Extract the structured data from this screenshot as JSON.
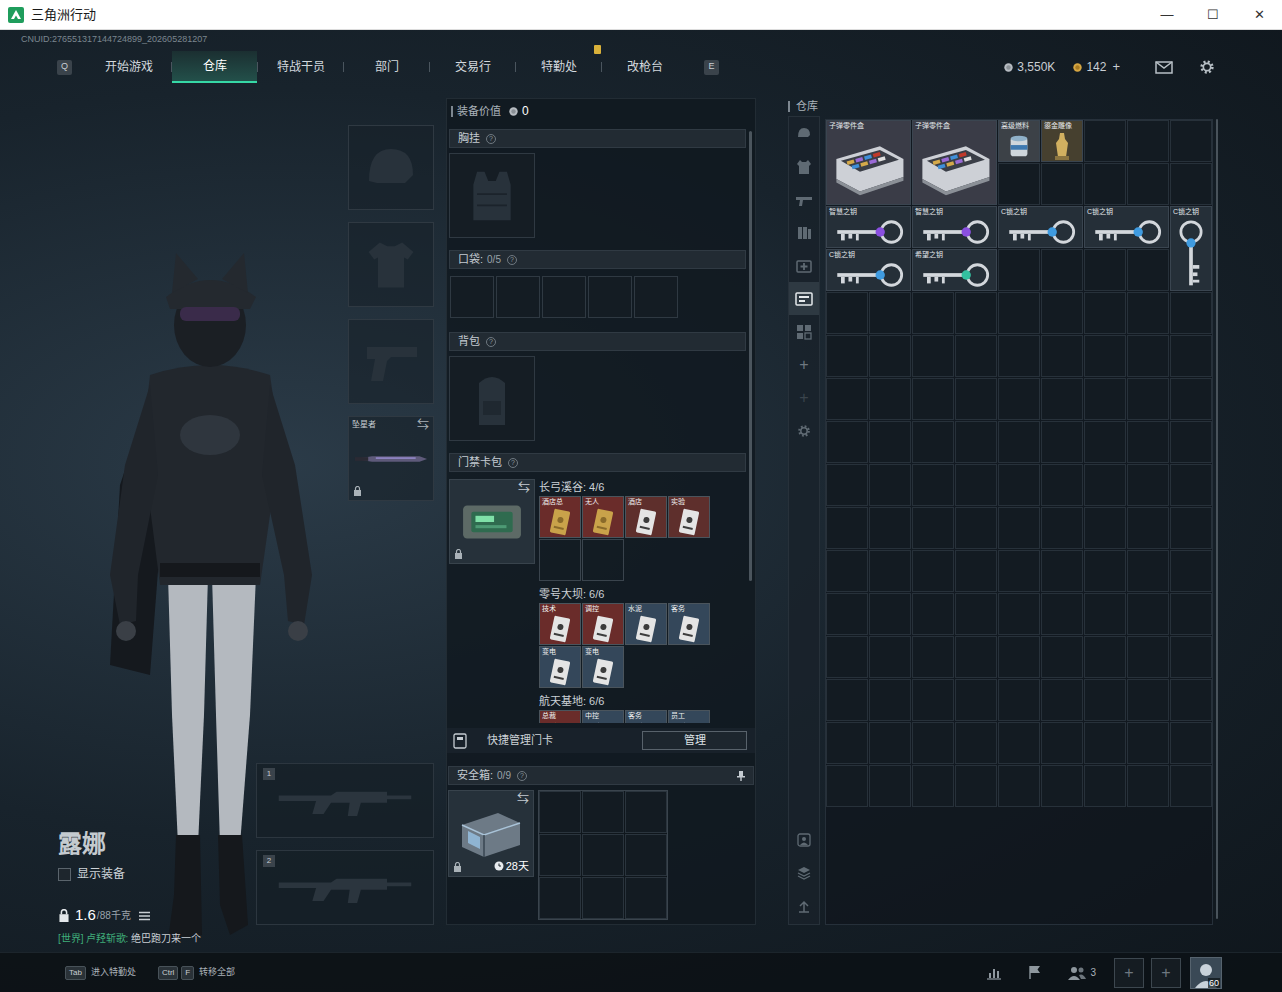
{
  "window": {
    "title": "三角洲行动",
    "controls": [
      "—",
      "☐",
      "✕"
    ]
  },
  "cnuid": "CNUID:276551317144724899_202605281207",
  "nav": {
    "prev_key": "Q",
    "next_key": "E",
    "tabs": [
      {
        "label": "开始游戏",
        "selected": false,
        "badge": false
      },
      {
        "label": "仓库",
        "selected": true,
        "badge": false
      },
      {
        "label": "特战干员",
        "selected": false,
        "badge": false
      },
      {
        "label": "部门",
        "selected": false,
        "badge": false
      },
      {
        "label": "交易行",
        "selected": false,
        "badge": false
      },
      {
        "label": "特勤处",
        "selected": false,
        "badge": true
      },
      {
        "label": "改枪台",
        "selected": false,
        "badge": false
      }
    ],
    "currencies": [
      {
        "amount": "3,550K",
        "kind": "silver"
      },
      {
        "amount": "142",
        "kind": "gold",
        "add": "+"
      }
    ]
  },
  "operator": {
    "name": "露娜",
    "show_equipment": {
      "label": "显示装备",
      "checked": false
    },
    "weight": "1.6",
    "weight_max": "/88千克"
  },
  "chat": {
    "channel": "[世界]",
    "sender": "卢羟斩歌:",
    "message": "绝巴跑刀来一个"
  },
  "gear_slots": [
    {
      "kind": "helmet"
    },
    {
      "kind": "armor"
    },
    {
      "kind": "pistol"
    },
    {
      "kind": "melee",
      "label": "坠星者",
      "swap": "⇆",
      "locked": true
    }
  ],
  "weapon_slots": [
    {
      "number": "1"
    },
    {
      "number": "2"
    }
  ],
  "loadout": {
    "value_label": "装备价值",
    "value": "0",
    "chest_rig": {
      "title": "胸挂",
      "help": "?"
    },
    "pockets": {
      "title": "口袋:",
      "count": "0/5",
      "help": "?",
      "slots": [
        {
          "filled": false
        },
        {
          "filled": false
        },
        {
          "filled": false
        },
        {
          "filled": false
        },
        {
          "filled": false
        }
      ]
    },
    "backpack": {
      "title": "背包",
      "help": "?"
    },
    "keycard_case": {
      "title": "门禁卡包",
      "help": "?",
      "swap": "⇆",
      "locked": true,
      "groups": [
        {
          "name": "长弓溪谷: 4/6",
          "slots": [
            {
              "filled": true,
              "label": "酒店总",
              "kind": "gold",
              "color": "#6a2c2a"
            },
            {
              "filled": true,
              "label": "无人",
              "kind": "gold",
              "color": "#6a2c2a"
            },
            {
              "filled": true,
              "label": "酒店",
              "kind": "white",
              "color": "#5e2f2c"
            },
            {
              "filled": true,
              "label": "实验",
              "kind": "white",
              "color": "#5e2f2c"
            },
            {
              "filled": false
            },
            {
              "filled": false
            }
          ]
        },
        {
          "name": "零号大坝: 6/6",
          "slots": [
            {
              "filled": true,
              "label": "技术",
              "kind": "white",
              "color": "#6a2c2a"
            },
            {
              "filled": true,
              "label": "调控",
              "kind": "white",
              "color": "#6a2c2a"
            },
            {
              "filled": true,
              "label": "水泥",
              "kind": "white",
              "color": "#34475a"
            },
            {
              "filled": true,
              "label": "客务",
              "kind": "white",
              "color": "#34475a"
            },
            {
              "filled": true,
              "label": "变电",
              "kind": "white",
              "color": "#34475a"
            },
            {
              "filled": true,
              "label": "变电",
              "kind": "white",
              "color": "#34475a"
            }
          ]
        },
        {
          "name": "航天基地: 6/6",
          "slots": [
            {
              "filled": true,
              "label": "总裁",
              "kind": "gold",
              "color": "#6a2c2a"
            },
            {
              "filled": true,
              "label": "中控",
              "kind": "white",
              "color": "#34475a"
            },
            {
              "filled": true,
              "label": "客务",
              "kind": "white",
              "color": "#34475a"
            },
            {
              "filled": true,
              "label": "员工",
              "kind": "white",
              "color": "#34475a"
            }
          ]
        }
      ]
    },
    "quick_manage": {
      "label": "快捷管理门卡",
      "button": "管理"
    },
    "safe_box": {
      "title": "安全箱:",
      "count": "0/9",
      "help": "?",
      "swap": "⇆",
      "locked": true,
      "timer": "28天",
      "slots": [
        {
          "filled": false
        },
        {
          "filled": false
        },
        {
          "filled": false
        },
        {
          "filled": false
        },
        {
          "filled": false
        },
        {
          "filled": false
        },
        {
          "filled": false
        },
        {
          "filled": false
        },
        {
          "filled": false
        }
      ]
    }
  },
  "warehouse": {
    "title": "仓库",
    "storage_tabs": [
      {
        "selected": false
      },
      {
        "selected": false
      },
      {
        "selected": false
      },
      {
        "selected": false
      },
      {
        "selected": false
      },
      {
        "selected": true
      },
      {
        "selected": false
      }
    ],
    "add_buttons": [
      {
        "label": "+",
        "disabled": false
      },
      {
        "label": "+",
        "disabled": true
      }
    ],
    "items": [
      {
        "label": "子弹零件盒",
        "kind": "box",
        "color": "#9a6ad6"
      },
      {
        "label": "子弹零件盒",
        "kind": "box",
        "color": "#9a6ad6"
      },
      {
        "label": "高级燃料",
        "kind": "fuel",
        "color": "#3f79b0"
      },
      {
        "label": "鎏金雕像",
        "kind": "statue",
        "color": "#d1b060"
      },
      {
        "label": "智慧之钥",
        "kind": "key",
        "color": "#8a4fe0"
      },
      {
        "label": "智慧之钥",
        "kind": "key",
        "color": "#8a4fe0"
      },
      {
        "label": "C锁之钥",
        "kind": "key",
        "color": "#3f9be0"
      },
      {
        "label": "C锁之钥",
        "kind": "key",
        "color": "#3f9be0"
      },
      {
        "label": "C锁之钥",
        "kind": "vkey",
        "color": "#3f9be0"
      },
      {
        "label": "C锁之钥",
        "kind": "key",
        "color": "#3f9be0"
      },
      {
        "label": "希望之钥",
        "kind": "key",
        "color": "#33c0a0"
      }
    ]
  },
  "bottom_bar": {
    "hints": [
      {
        "keys": [
          "Tab"
        ],
        "label": "进入特勤处"
      },
      {
        "keys": [
          "Ctrl",
          "F"
        ],
        "label": "转移全部"
      }
    ],
    "squad_count": "3",
    "add_slots": [
      "+",
      "+"
    ],
    "level": "60"
  }
}
